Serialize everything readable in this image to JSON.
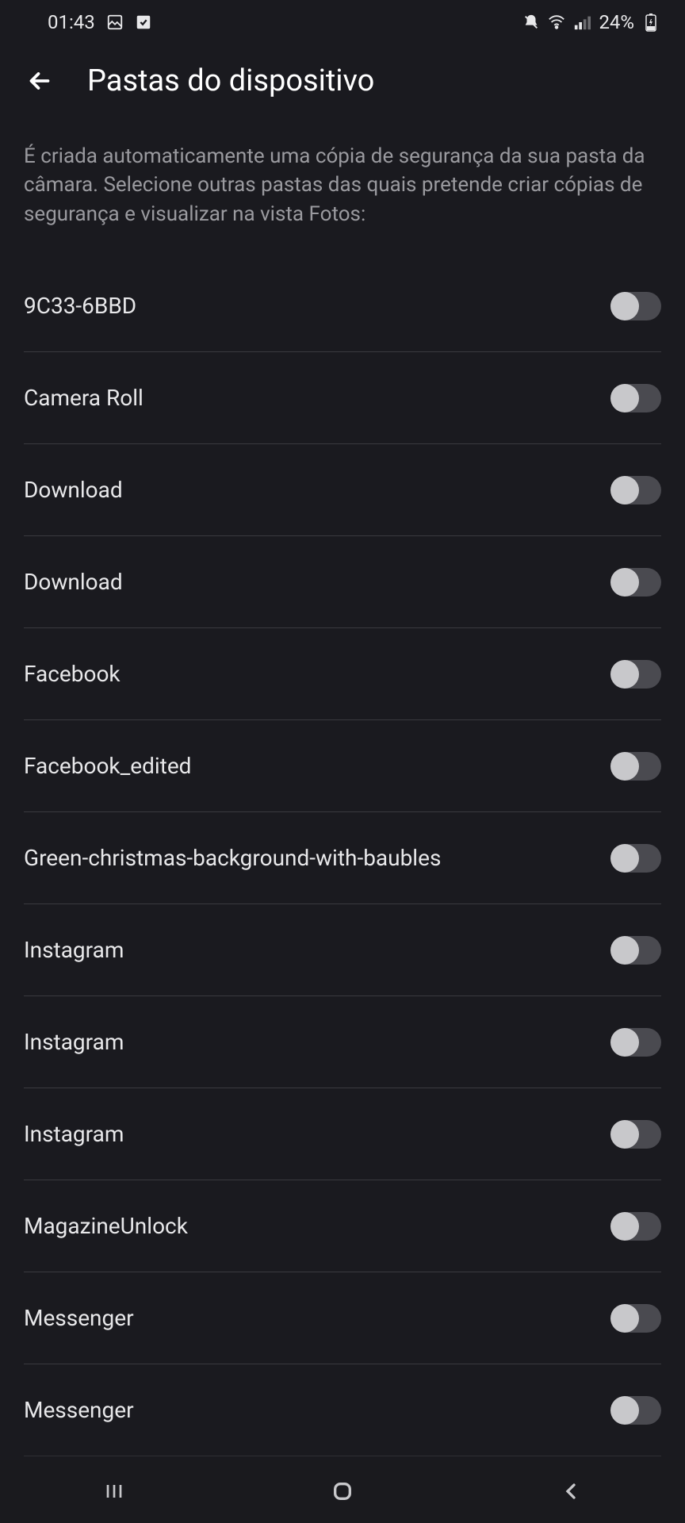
{
  "status_bar": {
    "time": "01:43",
    "battery": "24%"
  },
  "header": {
    "title": "Pastas do dispositivo"
  },
  "description": "É criada automaticamente uma cópia de segurança da sua pasta da câmara. Selecione outras pastas das quais pretende criar cópias de segurança e visualizar na vista Fotos:",
  "folders": [
    {
      "name": "9C33-6BBD",
      "enabled": false
    },
    {
      "name": "Camera Roll",
      "enabled": false
    },
    {
      "name": "Download",
      "enabled": false
    },
    {
      "name": "Download",
      "enabled": false
    },
    {
      "name": "Facebook",
      "enabled": false
    },
    {
      "name": "Facebook_edited",
      "enabled": false
    },
    {
      "name": "Green-christmas-background-with-baubles",
      "enabled": false
    },
    {
      "name": "Instagram",
      "enabled": false
    },
    {
      "name": "Instagram",
      "enabled": false
    },
    {
      "name": "Instagram",
      "enabled": false
    },
    {
      "name": "MagazineUnlock",
      "enabled": false
    },
    {
      "name": "Messenger",
      "enabled": false
    },
    {
      "name": "Messenger",
      "enabled": false
    }
  ]
}
